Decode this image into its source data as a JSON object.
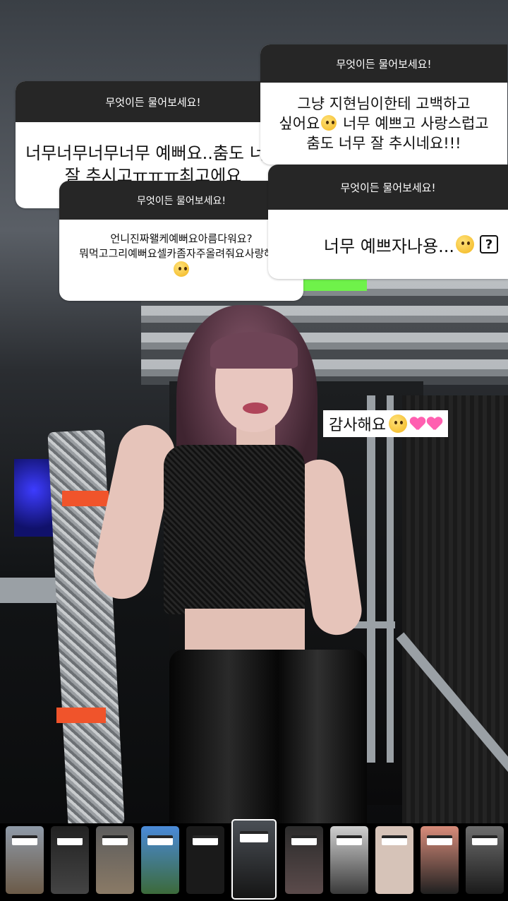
{
  "stickers": [
    {
      "header": "무엇이든 물어보세요!",
      "body": "너무너무너무너무 예뻐요..춤도 너무 잘 추시고ㅠㅠㅠ최고에요"
    },
    {
      "header": "무엇이든 물어보세요!",
      "body_line1": "그냥 지현님이한테 고백하고",
      "body_line2_pre": "싶어요",
      "body_line2_post": " 너무 예쁘고 사랑스럽고",
      "body_line3": "춤도 너무 잘 추시네요!!!"
    },
    {
      "header": "무엇이든 물어보세요!",
      "body_line1": "언니진짜왤케예뻐요아름다워요?",
      "body_line2": "뭐먹고그리예뻐요셀카좀자주올려줘요사랑해요"
    },
    {
      "header": "무엇이든 물어보세요!",
      "body": "너무 예쁘자나용...",
      "mark": "?"
    }
  ],
  "reply": {
    "text": "감사해요"
  },
  "icons": [
    "pleading-face-emoji",
    "shocked-face-emoji",
    "smiling-face-emoji",
    "pink-heart-emoji",
    "question-mark-icon"
  ],
  "thumbnails": {
    "count": 11,
    "selected_index": 5
  }
}
